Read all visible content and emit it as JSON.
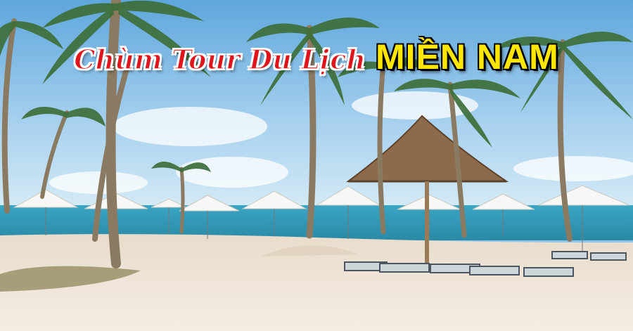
{
  "banner": {
    "title_script": "Chùm Tour Du Lịch",
    "title_region": "MIỀN NAM"
  },
  "colors": {
    "sky": "#8fc3e8",
    "sea": "#2f93b3",
    "sand": "#efe6da",
    "title_red": "#e0141b",
    "title_yellow": "#ffe600"
  }
}
